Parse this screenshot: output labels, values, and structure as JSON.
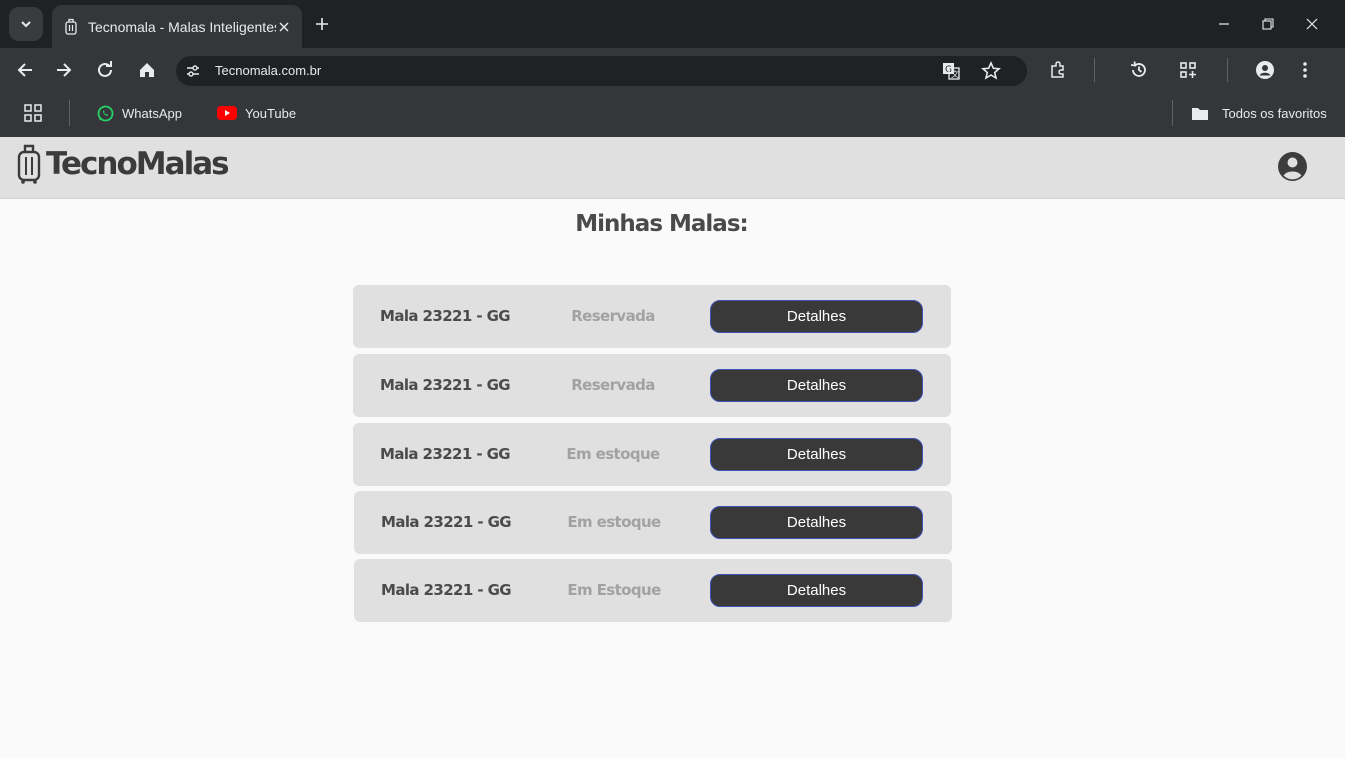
{
  "browser": {
    "tab_title": "Tecnomala - Malas Inteligentes",
    "url": "Tecnomala.com.br",
    "bookmarks": [
      {
        "label": "WhatsApp",
        "icon": "whatsapp-icon",
        "color": "#25d366"
      },
      {
        "label": "YouTube",
        "icon": "youtube-icon",
        "color": "#ff0000"
      }
    ],
    "all_bookmarks_label": "Todos os favoritos"
  },
  "app": {
    "logo_text": "TecnoMalas",
    "page_title": "Minhas Malas:",
    "accent_color": "#3f51b5",
    "luggage": [
      {
        "name": "Mala 23221 - GG",
        "status": "Reservada",
        "button": "Detalhes"
      },
      {
        "name": "Mala 23221 - GG",
        "status": "Reservada",
        "button": "Detalhes"
      },
      {
        "name": "Mala 23221 - GG",
        "status": "Em estoque",
        "button": "Detalhes"
      },
      {
        "name": "Mala 23221 - GG",
        "status": "Em estoque",
        "button": "Detalhes"
      },
      {
        "name": "Mala 23221 - GG",
        "status": "Em Estoque",
        "button": "Detalhes"
      }
    ]
  }
}
